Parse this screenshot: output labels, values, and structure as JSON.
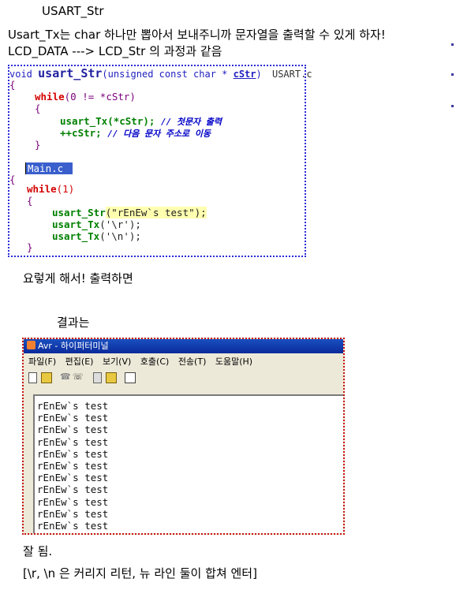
{
  "heading": "USART_Str",
  "intro_line1": "Usart_Tx는 char 하나만 뽑아서 보내주니까 문자열을 출력할 수 있게 하자!",
  "intro_line2": "LCD_DATA ---> LCD_Str 의 과정과 같음",
  "code_header": {
    "void": "void",
    "fname": "usart_Str",
    "params_a": "(unsigned const char * ",
    "param": "cStr",
    "params_b": ")",
    "file": "USART.c"
  },
  "code_func": {
    "brace_open": "{",
    "while_kw": "while",
    "while_cond": "(0 != *cStr)",
    "inner_open": "{",
    "call1": "usart_Tx(*cStr);",
    "comment1": "// 첫문자 출력",
    "call2": "++cStr;",
    "comment2": "// 다음 문자 주소로 이동",
    "inner_close": "}"
  },
  "code_main": {
    "file": "Main.c",
    "brace_open": "{",
    "while_kw": "while",
    "while_cond": "(1)",
    "inner_open": "{",
    "line1_fn": "usart_Str",
    "line1_arg": "(\"rEnEw`s test\");",
    "line2_fn": "usart_Tx",
    "line2_arg": "('\\r');",
    "line3_fn": "usart_Tx",
    "line3_arg": "('\\n');",
    "inner_close": "}"
  },
  "mid_text": "요렇게 해서! 출력하면",
  "result_label": "결과는",
  "terminal": {
    "title": "Avr - 하이퍼터미널",
    "menu": [
      "파일(F)",
      "편집(E)",
      "보기(V)",
      "호출(C)",
      "전송(T)",
      "도움말(H)"
    ],
    "lines": [
      "rEnEw`s test",
      "rEnEw`s test",
      "rEnEw`s test",
      "rEnEw`s test",
      "rEnEw`s test",
      "rEnEw`s test",
      "rEnEw`s test",
      "rEnEw`s test",
      "rEnEw`s test",
      "rEnEw`s test",
      "rEnEw`s test"
    ]
  },
  "ok_text": "잘 됨.",
  "footer_text": "[\\r, \\n 은 커리지 리턴, 뉴 라인 둘이 합쳐 엔터]"
}
